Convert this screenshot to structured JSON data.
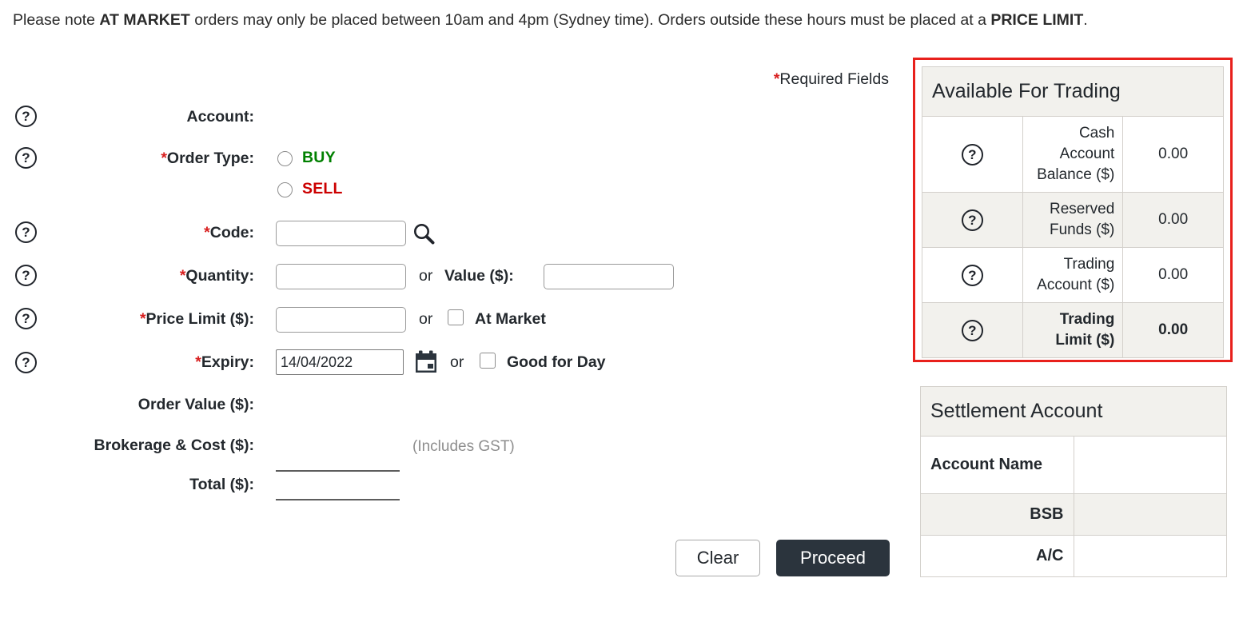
{
  "notice": {
    "pre": "Please note ",
    "bold1": "AT MARKET",
    "mid": " orders may only be placed between 10am and 4pm (Sydney time). Orders outside these hours must be placed at a ",
    "bold2": "PRICE LIMIT",
    "post": "."
  },
  "required_note": {
    "asterisk": "*",
    "text": "Required Fields"
  },
  "form": {
    "account_label": "Account:",
    "order_type_label": "Order Type:",
    "buy_label": "BUY",
    "sell_label": "SELL",
    "code_label": "Code:",
    "code_value": "",
    "quantity_label": "Quantity:",
    "quantity_value": "",
    "or_word": "or",
    "value_label": "Value ($):",
    "value_value": "",
    "price_limit_label": "Price Limit ($):",
    "price_limit_value": "",
    "at_market_label": "At Market",
    "expiry_label": "Expiry:",
    "expiry_value": "14/04/2022",
    "good_for_day_label": "Good for Day",
    "order_value_label": "Order Value ($):",
    "brokerage_label": "Brokerage & Cost ($):",
    "includes_gst": "(Includes GST)",
    "total_label": "Total ($):",
    "help_glyph": "?",
    "asterisk": "*"
  },
  "buttons": {
    "clear": "Clear",
    "proceed": "Proceed"
  },
  "available_for_trading": {
    "title": "Available For Trading",
    "rows": [
      {
        "label": "Cash Account Balance ($)",
        "value": "0.00"
      },
      {
        "label": "Reserved Funds ($)",
        "value": "0.00"
      },
      {
        "label": "Trading Account ($)",
        "value": "0.00"
      },
      {
        "label": "Trading Limit ($)",
        "value": "0.00"
      }
    ]
  },
  "settlement_account": {
    "title": "Settlement Account",
    "rows": [
      {
        "label": "Account Name",
        "value": ""
      },
      {
        "label": "BSB",
        "value": ""
      },
      {
        "label": "A/C",
        "value": ""
      }
    ]
  },
  "colors": {
    "buy": "#008000",
    "sell": "#cc0000",
    "required_asterisk": "#d81f1f",
    "panel_border": "#e8201c",
    "proceed_bg": "#2b343d"
  }
}
